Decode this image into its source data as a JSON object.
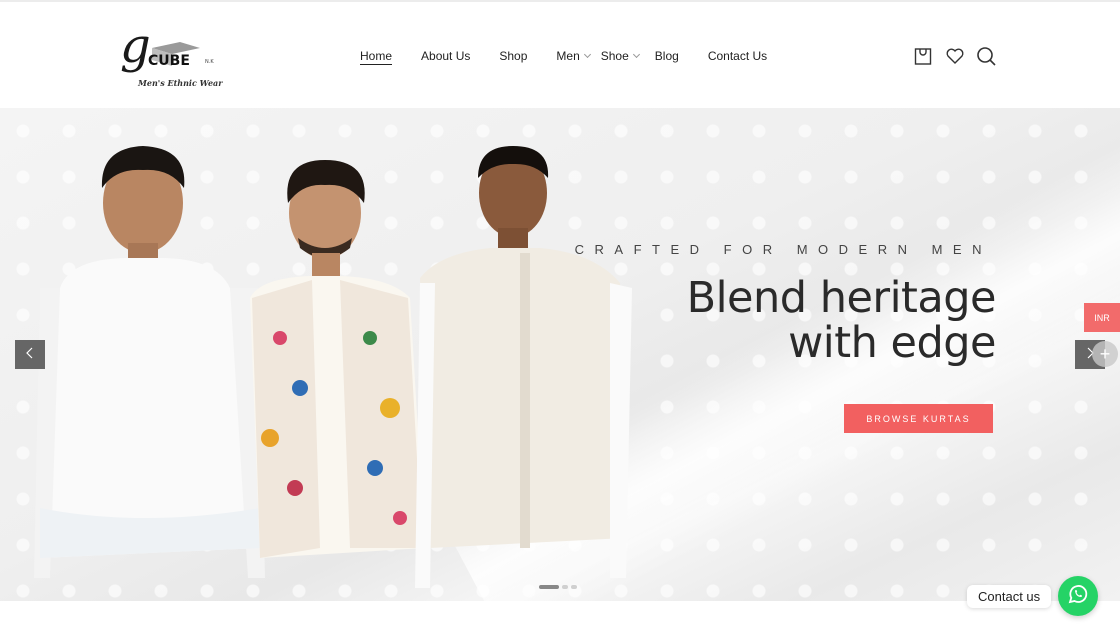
{
  "brand": {
    "logo_text": "CUBE",
    "logo_mark": "g",
    "logo_sub": "N.K",
    "tagline": "Men's Ethnic Wear"
  },
  "nav": {
    "home": "Home",
    "about": "About Us",
    "shop": "Shop",
    "men": "Men",
    "shoe": "Shoe",
    "blog": "Blog",
    "contact": "Contact Us"
  },
  "header_icons": [
    "cart-icon",
    "heart-icon",
    "search-icon"
  ],
  "hero": {
    "eyebrow": "CRAFTED FOR MODERN MEN",
    "headline_line1": "Blend heritage",
    "headline_line2": "with edge",
    "cta": "BROWSE KURTAS",
    "slide_count": 3,
    "active_slide": 1
  },
  "currency": {
    "code": "INR"
  },
  "widget": {
    "contact_label": "Contact us"
  },
  "colors": {
    "accent": "#f26060",
    "whatsapp": "#25d366",
    "arrow_bg": "#666666"
  }
}
